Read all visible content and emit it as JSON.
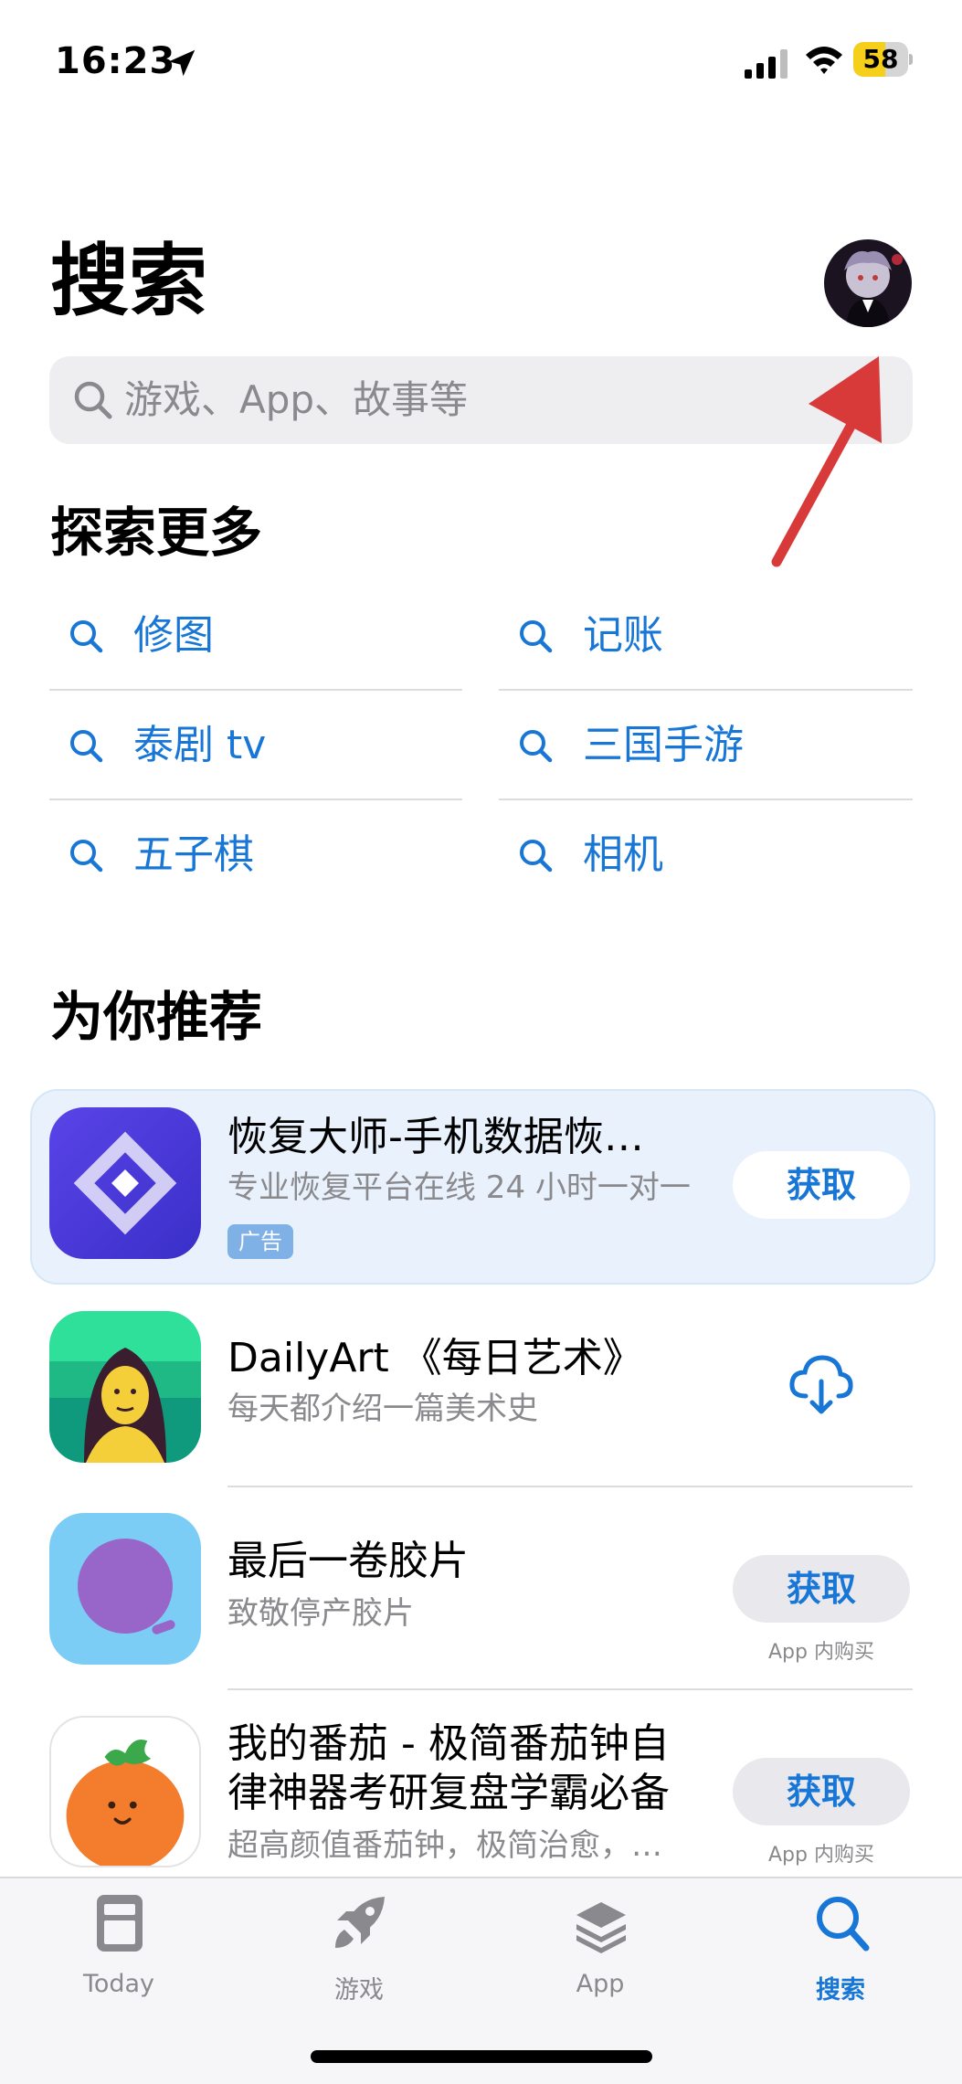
{
  "status_bar": {
    "time": "16:23",
    "battery": "58",
    "battery_level": 0.58
  },
  "page": {
    "title": "搜索"
  },
  "search": {
    "placeholder": "游戏、App、故事等"
  },
  "explore": {
    "title": "探索更多",
    "items": [
      {
        "label": "修图"
      },
      {
        "label": "记账"
      },
      {
        "label": "泰剧 tv"
      },
      {
        "label": "三国手游"
      },
      {
        "label": "五子棋"
      },
      {
        "label": "相机"
      }
    ]
  },
  "recommend": {
    "title": "为你推荐",
    "apps": [
      {
        "name": "恢复大师-手机数据恢…",
        "subtitle": "专业恢复平台在线 24 小时一对一",
        "badge": "广告",
        "action": "获取",
        "icon": "restore-master-icon"
      },
      {
        "name": "DailyArt 《每日艺术》",
        "subtitle": "每天都介绍一篇美术史",
        "action": "download-cloud",
        "icon": "dailyart-icon"
      },
      {
        "name": "最后一卷胶片",
        "subtitle": "致敬停产胶片",
        "action": "获取",
        "note": "App 内购买",
        "icon": "last-film-icon"
      },
      {
        "name_line1": "我的番茄 - 极简番茄钟自",
        "name_line2": "律神器考研复盘学霸必备",
        "subtitle": "超高颜值番茄钟，极简治愈，…",
        "action": "获取",
        "note": "App 内购买",
        "icon": "tomato-icon"
      }
    ]
  },
  "tabbar": {
    "tabs": [
      {
        "label": "Today",
        "icon": "today-icon"
      },
      {
        "label": "游戏",
        "icon": "rocket-icon"
      },
      {
        "label": "App",
        "icon": "layers-icon"
      },
      {
        "label": "搜索",
        "icon": "search-icon",
        "active": true
      }
    ]
  },
  "colors": {
    "accent": "#1877d6",
    "annotation_arrow": "#d83a3a",
    "battery": "#f5cf1a"
  }
}
